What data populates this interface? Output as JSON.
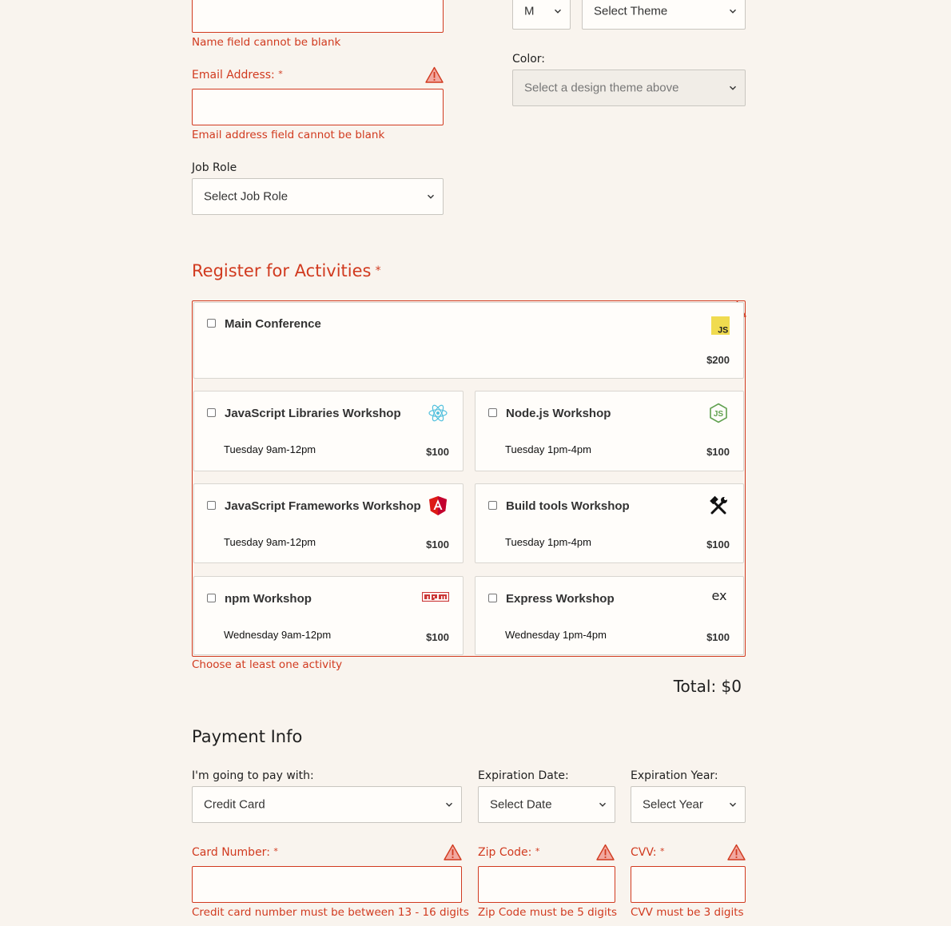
{
  "basic_info": {
    "name_error": "Name field cannot be blank",
    "email_label": "Email Address:",
    "required_mark": "*",
    "email_error": "Email address field cannot be blank",
    "job_role_label": "Job Role",
    "job_role_value": "Select Job Role"
  },
  "tshirt": {
    "size_value": "M",
    "design_value": "Select Theme",
    "color_label": "Color:",
    "color_value": "Select a design theme above"
  },
  "activities": {
    "title": "Register for Activities",
    "required_mark": "*",
    "error": "Choose at least one activity",
    "total": "Total: $0",
    "items": [
      {
        "name": "Main Conference",
        "time": "",
        "cost": "$200",
        "icon": "js-icon",
        "checked": false
      },
      {
        "name": "JavaScript Libraries Workshop",
        "time": "Tuesday 9am-12pm",
        "cost": "$100",
        "icon": "react-icon",
        "checked": false
      },
      {
        "name": "Node.js Workshop",
        "time": "Tuesday 1pm-4pm",
        "cost": "$100",
        "icon": "nodejs-icon",
        "checked": false
      },
      {
        "name": "JavaScript Frameworks Workshop",
        "time": "Tuesday 9am-12pm",
        "cost": "$100",
        "icon": "angular-icon",
        "checked": false
      },
      {
        "name": "Build tools Workshop",
        "time": "Tuesday 1pm-4pm",
        "cost": "$100",
        "icon": "build-tools-icon",
        "checked": false
      },
      {
        "name": "npm Workshop",
        "time": "Wednesday 9am-12pm",
        "cost": "$100",
        "icon": "npm-icon",
        "checked": false
      },
      {
        "name": "Express Workshop",
        "time": "Wednesday 1pm-4pm",
        "cost": "$100",
        "icon": "express-icon",
        "checked": false
      }
    ]
  },
  "payment": {
    "title": "Payment Info",
    "pay_with_label": "I'm going to pay with:",
    "pay_with_value": "Credit Card",
    "exp_date_label": "Expiration Date:",
    "exp_date_value": "Select Date",
    "exp_year_label": "Expiration Year:",
    "exp_year_value": "Select Year",
    "card_label": "Card Number:",
    "zip_label": "Zip Code:",
    "cvv_label": "CVV:",
    "required_mark": "*",
    "card_error": "Credit card number must be between 13 - 16 digits",
    "zip_error": "Zip Code must be 5 digits",
    "cvv_error": "CVV must be 3 digits"
  },
  "colors": {
    "error": "#d13a1f",
    "background": "#f9f4ee",
    "field_bg": "#fffdfa"
  }
}
